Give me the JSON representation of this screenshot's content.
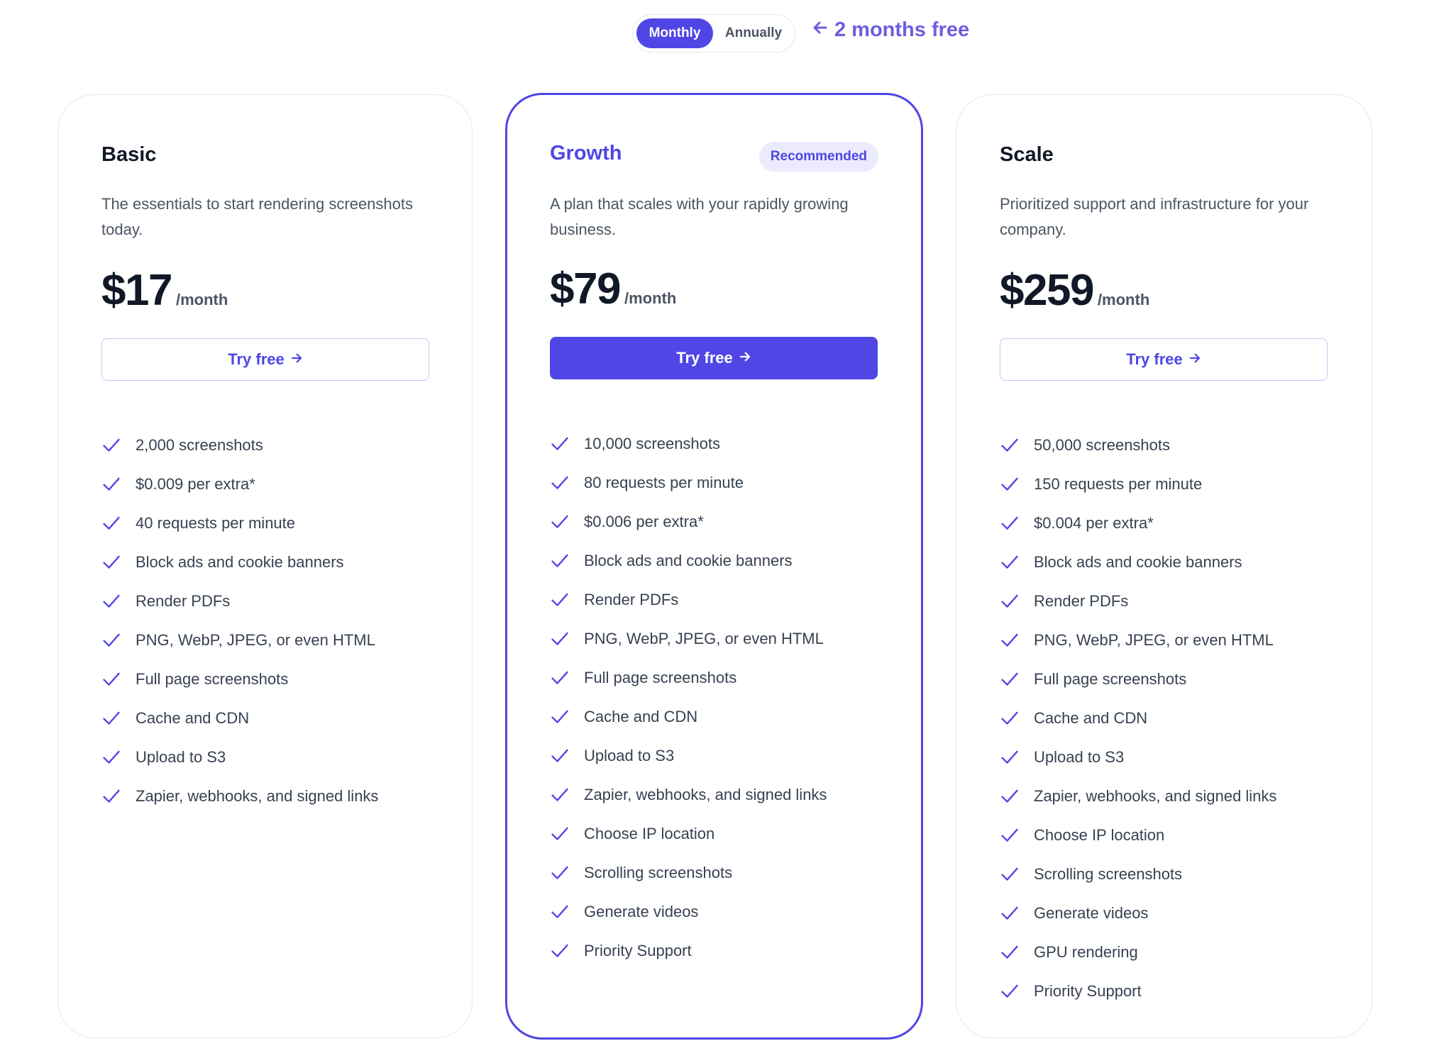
{
  "billing_toggle": {
    "options": [
      {
        "label": "Monthly",
        "selected": true
      },
      {
        "label": "Annually",
        "selected": false
      }
    ],
    "promo_icon": "arrow-left-icon",
    "promo_text": "2 months free"
  },
  "colors": {
    "accent": "#4f46e5",
    "badge_bg": "#ecebfd",
    "promo": "#6d5ee0",
    "text_dark": "#111827",
    "text_muted": "#4b5563",
    "card_border": "#e5e7eb"
  },
  "plans": [
    {
      "name": "Basic",
      "description": "The essentials to start rendering screenshots today.",
      "price": "$17",
      "period": "/month",
      "cta_label": "Try free",
      "cta_icon": "arrow-right-icon",
      "features": [
        "2,000 screenshots",
        "$0.009 per extra*",
        "40 requests per minute",
        "Block ads and cookie banners",
        "Render PDFs",
        "PNG, WebP, JPEG, or even HTML",
        "Full page screenshots",
        "Cache and CDN",
        "Upload to S3",
        "Zapier, webhooks, and signed links"
      ]
    },
    {
      "name": "Growth",
      "badge": "Recommended",
      "description": "A plan that scales with your rapidly growing business.",
      "price": "$79",
      "period": "/month",
      "cta_label": "Try free",
      "cta_icon": "arrow-right-icon",
      "features": [
        "10,000 screenshots",
        "80 requests per minute",
        "$0.006 per extra*",
        "Block ads and cookie banners",
        "Render PDFs",
        "PNG, WebP, JPEG, or even HTML",
        "Full page screenshots",
        "Cache and CDN",
        "Upload to S3",
        "Zapier, webhooks, and signed links",
        "Choose IP location",
        "Scrolling screenshots",
        "Generate videos",
        "Priority Support"
      ]
    },
    {
      "name": "Scale",
      "description": "Prioritized support and infrastructure for your company.",
      "price": "$259",
      "period": "/month",
      "cta_label": "Try free",
      "cta_icon": "arrow-right-icon",
      "features": [
        "50,000 screenshots",
        "150 requests per minute",
        "$0.004 per extra*",
        "Block ads and cookie banners",
        "Render PDFs",
        "PNG, WebP, JPEG, or even HTML",
        "Full page screenshots",
        "Cache and CDN",
        "Upload to S3",
        "Zapier, webhooks, and signed links",
        "Choose IP location",
        "Scrolling screenshots",
        "Generate videos",
        "GPU rendering",
        "Priority Support"
      ]
    }
  ]
}
